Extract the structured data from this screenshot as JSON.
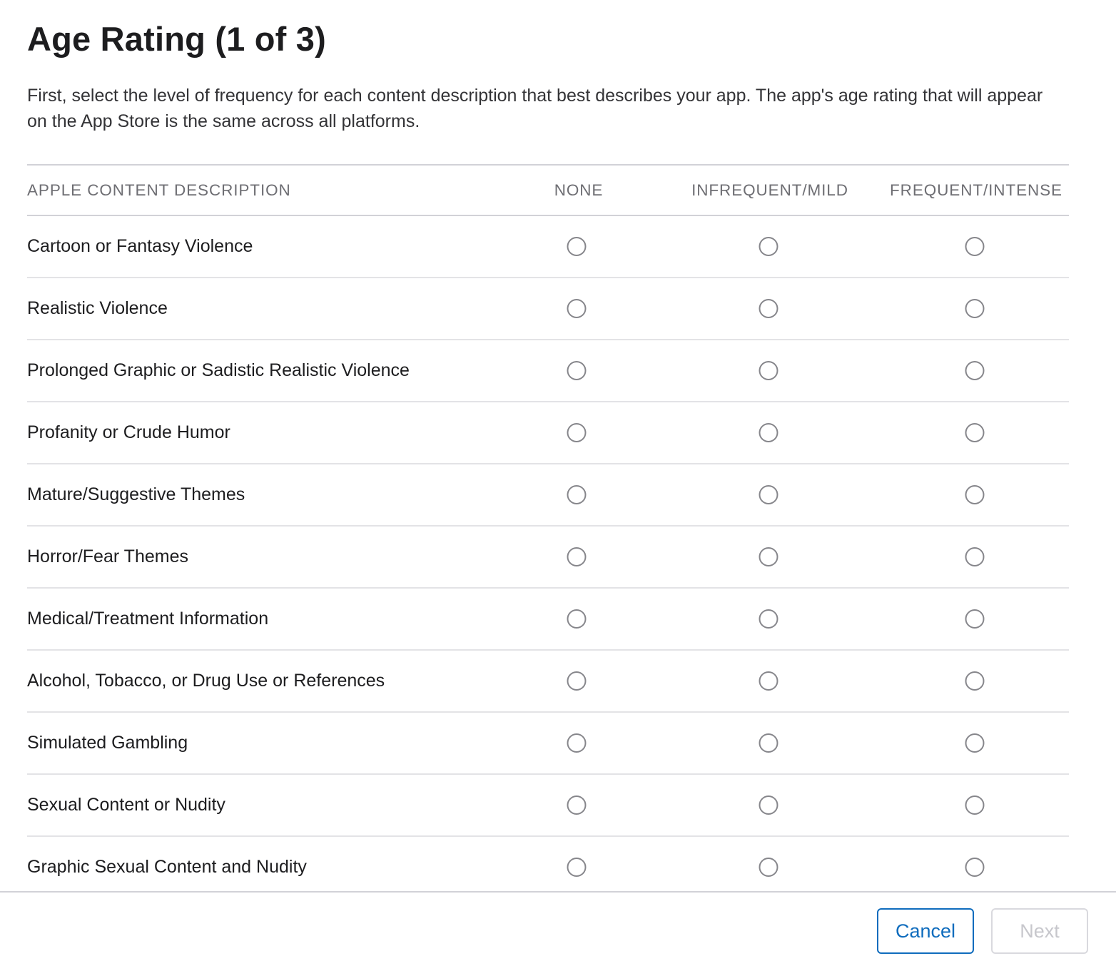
{
  "dialog": {
    "title": "Age Rating (1 of 3)",
    "description": "First, select the level of frequency for each content description that best describes your app. The app's age rating that will appear on the App Store is the same across all platforms."
  },
  "table": {
    "headers": {
      "description": "APPLE CONTENT DESCRIPTION",
      "none": "NONE",
      "mild": "INFREQUENT/MILD",
      "intense": "FREQUENT/INTENSE"
    },
    "rows": [
      {
        "label": "Cartoon or Fantasy Violence",
        "selected": null
      },
      {
        "label": "Realistic Violence",
        "selected": null
      },
      {
        "label": "Prolonged Graphic or Sadistic Realistic Violence",
        "selected": null
      },
      {
        "label": "Profanity or Crude Humor",
        "selected": null
      },
      {
        "label": "Mature/Suggestive Themes",
        "selected": null
      },
      {
        "label": "Horror/Fear Themes",
        "selected": null
      },
      {
        "label": "Medical/Treatment Information",
        "selected": null
      },
      {
        "label": "Alcohol, Tobacco, or Drug Use or References",
        "selected": null
      },
      {
        "label": "Simulated Gambling",
        "selected": null
      },
      {
        "label": "Sexual Content or Nudity",
        "selected": null
      },
      {
        "label": "Graphic Sexual Content and Nudity",
        "selected": null
      }
    ]
  },
  "footer": {
    "cancel_label": "Cancel",
    "next_label": "Next",
    "next_disabled": true
  },
  "colors": {
    "accent": "#0f6cbd",
    "disabled_text": "#c7c7cc",
    "divider": "#d2d2d7",
    "radio_border": "#86868b"
  }
}
